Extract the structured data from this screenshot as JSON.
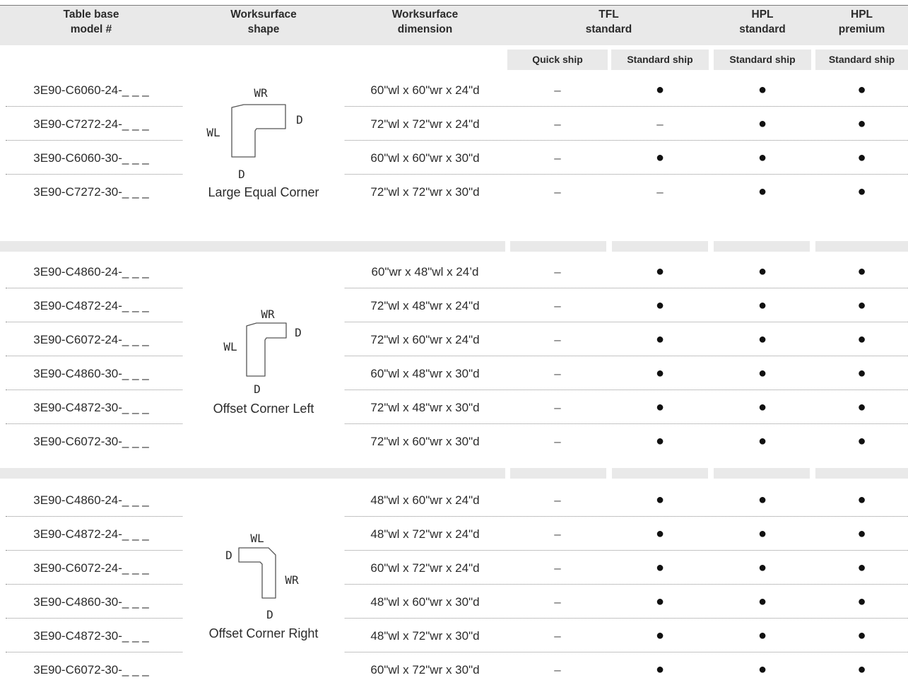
{
  "headers": {
    "model": "Table base\nmodel #",
    "shape": "Worksurface\nshape",
    "dimension": "Worksurface\ndimension",
    "tfl": "TFL\nstandard",
    "hpl_std": "HPL\nstandard",
    "hpl_prem": "HPL\npremium"
  },
  "subheaders": {
    "quick": "Quick ship",
    "tfl_std": "Standard ship",
    "hpl_std": "Standard ship",
    "hpl_prem": "Standard ship"
  },
  "symbols": {
    "dash": "–",
    "dot": "●"
  },
  "groups": [
    {
      "shape_name": "Large Equal Corner",
      "shape_labels": {
        "top": "WR",
        "side": "WL",
        "right": "D",
        "bottom": "D"
      },
      "rows": [
        {
          "model": "3E90-C6060-24-_ _ _",
          "dimension": "60\"wl x 60\"wr x 24\"d",
          "quick": "–",
          "tfl": "●",
          "hpl_std": "●",
          "hpl_prem": "●"
        },
        {
          "model": "3E90-C7272-24-_ _ _",
          "dimension": "72\"wl x 72\"wr x 24\"d",
          "quick": "–",
          "tfl": "–",
          "hpl_std": "●",
          "hpl_prem": "●"
        },
        {
          "model": "3E90-C6060-30-_ _ _",
          "dimension": "60\"wl x 60\"wr x 30\"d",
          "quick": "–",
          "tfl": "●",
          "hpl_std": "●",
          "hpl_prem": "●"
        },
        {
          "model": "3E90-C7272-30-_ _ _",
          "dimension": "72\"wl x 72\"wr x 30\"d",
          "quick": "–",
          "tfl": "–",
          "hpl_std": "●",
          "hpl_prem": "●"
        }
      ]
    },
    {
      "shape_name": "Offset Corner Left",
      "shape_labels": {
        "top": "WR",
        "side": "WL",
        "right": "D",
        "bottom": "D"
      },
      "rows": [
        {
          "model": "3E90-C4860-24-_ _ _",
          "dimension": "60\"wr x 48\"wl x 24’d",
          "quick": "–",
          "tfl": "●",
          "hpl_std": "●",
          "hpl_prem": "●"
        },
        {
          "model": "3E90-C4872-24-_ _ _",
          "dimension": "72\"wl x 48\"wr x 24\"d",
          "quick": "–",
          "tfl": "●",
          "hpl_std": "●",
          "hpl_prem": "●"
        },
        {
          "model": "3E90-C6072-24-_ _ _",
          "dimension": "72\"wl x 60\"wr x 24\"d",
          "quick": "–",
          "tfl": "●",
          "hpl_std": "●",
          "hpl_prem": "●"
        },
        {
          "model": "3E90-C4860-30-_ _ _",
          "dimension": "60\"wl x 48\"wr x 30\"d",
          "quick": "–",
          "tfl": "●",
          "hpl_std": "●",
          "hpl_prem": "●"
        },
        {
          "model": "3E90-C4872-30-_ _ _",
          "dimension": "72\"wl x 48\"wr x 30\"d",
          "quick": "–",
          "tfl": "●",
          "hpl_std": "●",
          "hpl_prem": "●"
        },
        {
          "model": "3E90-C6072-30-_ _ _",
          "dimension": "72\"wl x 60\"wr x 30\"d",
          "quick": "–",
          "tfl": "●",
          "hpl_std": "●",
          "hpl_prem": "●"
        }
      ]
    },
    {
      "shape_name": "Offset Corner Right",
      "shape_labels": {
        "top": "WL",
        "side": "D",
        "right": "WR",
        "bottom": "D"
      },
      "rows": [
        {
          "model": "3E90-C4860-24-_ _ _",
          "dimension": "48\"wl x 60\"wr x 24\"d",
          "quick": "–",
          "tfl": "●",
          "hpl_std": "●",
          "hpl_prem": "●"
        },
        {
          "model": "3E90-C4872-24-_ _ _",
          "dimension": "48\"wl x 72\"wr x 24\"d",
          "quick": "–",
          "tfl": "●",
          "hpl_std": "●",
          "hpl_prem": "●"
        },
        {
          "model": "3E90-C6072-24-_ _ _",
          "dimension": "60\"wl x 72\"wr x 24\"d",
          "quick": "–",
          "tfl": "●",
          "hpl_std": "●",
          "hpl_prem": "●"
        },
        {
          "model": "3E90-C4860-30-_ _ _",
          "dimension": "48\"wl x 60\"wr x 30\"d",
          "quick": "–",
          "tfl": "●",
          "hpl_std": "●",
          "hpl_prem": "●"
        },
        {
          "model": "3E90-C4872-30-_ _ _",
          "dimension": "48\"wl x 72\"wr x 30\"d",
          "quick": "–",
          "tfl": "●",
          "hpl_std": "●",
          "hpl_prem": "●"
        },
        {
          "model": "3E90-C6072-30-_ _ _",
          "dimension": "60\"wl x 72\"wr x 30\"d",
          "quick": "–",
          "tfl": "●",
          "hpl_std": "●",
          "hpl_prem": "●"
        }
      ]
    }
  ],
  "colors": {
    "header_bg": "#e9e9e9",
    "text": "#2b2b2b"
  }
}
